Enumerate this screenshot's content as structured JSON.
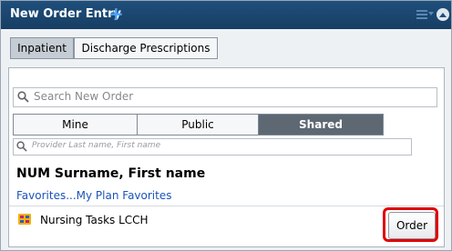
{
  "window": {
    "title": "New Order Entry"
  },
  "tabs": [
    {
      "label": "Inpatient",
      "active": true
    },
    {
      "label": "Discharge Prescriptions",
      "active": false
    }
  ],
  "search": {
    "placeholder": "Search New Order"
  },
  "segments": [
    {
      "label": "Mine",
      "selected": false
    },
    {
      "label": "Public",
      "selected": false
    },
    {
      "label": "Shared",
      "selected": true
    }
  ],
  "provider_search": {
    "placeholder": "Provider Last name, First name"
  },
  "patient": {
    "name": "NUM Surname, First name"
  },
  "favorites": {
    "link_text": "Favorites...My Plan Favorites"
  },
  "task": {
    "label": "Nursing Tasks LCCH",
    "icon": "nursing-task-icon"
  },
  "order_button": {
    "label": "Order"
  },
  "colors": {
    "titlebar": "#1f4f7c",
    "highlight": "#e00000",
    "link": "#1b54b8",
    "segment_selected": "#5d6873"
  }
}
